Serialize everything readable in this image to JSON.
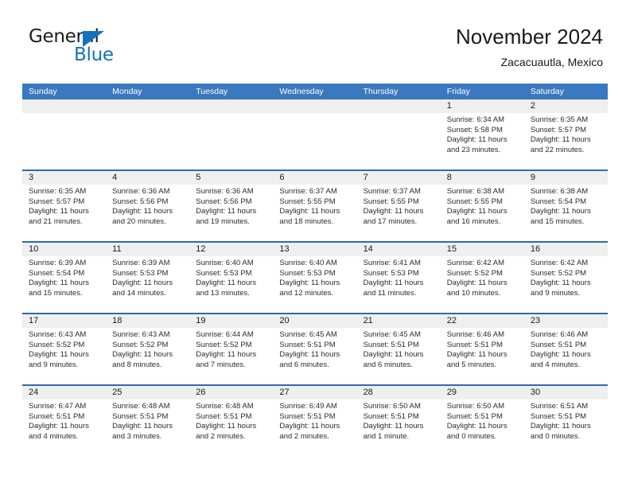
{
  "brand": {
    "name_part1": "General",
    "name_part2": "Blue",
    "accent_color": "#1272bd"
  },
  "header": {
    "title": "November 2024",
    "subtitle": "Zacacuautla, Mexico"
  },
  "colors": {
    "weekday_header_bg": "#3a79bf",
    "weekday_header_text": "#ffffff",
    "daynum_band_bg": "#efefef",
    "week_divider": "#2e6ca9"
  },
  "weekdays": [
    {
      "label": "Sunday"
    },
    {
      "label": "Monday"
    },
    {
      "label": "Tuesday"
    },
    {
      "label": "Wednesday"
    },
    {
      "label": "Thursday"
    },
    {
      "label": "Friday"
    },
    {
      "label": "Saturday"
    }
  ],
  "weeks": [
    {
      "days": [
        {
          "num": "",
          "lines": [
            "",
            "",
            "",
            ""
          ],
          "empty": true
        },
        {
          "num": "",
          "lines": [
            "",
            "",
            "",
            ""
          ],
          "empty": true
        },
        {
          "num": "",
          "lines": [
            "",
            "",
            "",
            ""
          ],
          "empty": true
        },
        {
          "num": "",
          "lines": [
            "",
            "",
            "",
            ""
          ],
          "empty": true
        },
        {
          "num": "",
          "lines": [
            "",
            "",
            "",
            ""
          ],
          "empty": true
        },
        {
          "num": "1",
          "lines": [
            "Sunrise: 6:34 AM",
            "Sunset: 5:58 PM",
            "Daylight: 11 hours",
            "and 23 minutes."
          ],
          "empty": false
        },
        {
          "num": "2",
          "lines": [
            "Sunrise: 6:35 AM",
            "Sunset: 5:57 PM",
            "Daylight: 11 hours",
            "and 22 minutes."
          ],
          "empty": false
        }
      ]
    },
    {
      "days": [
        {
          "num": "3",
          "lines": [
            "Sunrise: 6:35 AM",
            "Sunset: 5:57 PM",
            "Daylight: 11 hours",
            "and 21 minutes."
          ],
          "empty": false
        },
        {
          "num": "4",
          "lines": [
            "Sunrise: 6:36 AM",
            "Sunset: 5:56 PM",
            "Daylight: 11 hours",
            "and 20 minutes."
          ],
          "empty": false
        },
        {
          "num": "5",
          "lines": [
            "Sunrise: 6:36 AM",
            "Sunset: 5:56 PM",
            "Daylight: 11 hours",
            "and 19 minutes."
          ],
          "empty": false
        },
        {
          "num": "6",
          "lines": [
            "Sunrise: 6:37 AM",
            "Sunset: 5:55 PM",
            "Daylight: 11 hours",
            "and 18 minutes."
          ],
          "empty": false
        },
        {
          "num": "7",
          "lines": [
            "Sunrise: 6:37 AM",
            "Sunset: 5:55 PM",
            "Daylight: 11 hours",
            "and 17 minutes."
          ],
          "empty": false
        },
        {
          "num": "8",
          "lines": [
            "Sunrise: 6:38 AM",
            "Sunset: 5:55 PM",
            "Daylight: 11 hours",
            "and 16 minutes."
          ],
          "empty": false
        },
        {
          "num": "9",
          "lines": [
            "Sunrise: 6:38 AM",
            "Sunset: 5:54 PM",
            "Daylight: 11 hours",
            "and 15 minutes."
          ],
          "empty": false
        }
      ]
    },
    {
      "days": [
        {
          "num": "10",
          "lines": [
            "Sunrise: 6:39 AM",
            "Sunset: 5:54 PM",
            "Daylight: 11 hours",
            "and 15 minutes."
          ],
          "empty": false
        },
        {
          "num": "11",
          "lines": [
            "Sunrise: 6:39 AM",
            "Sunset: 5:53 PM",
            "Daylight: 11 hours",
            "and 14 minutes."
          ],
          "empty": false
        },
        {
          "num": "12",
          "lines": [
            "Sunrise: 6:40 AM",
            "Sunset: 5:53 PM",
            "Daylight: 11 hours",
            "and 13 minutes."
          ],
          "empty": false
        },
        {
          "num": "13",
          "lines": [
            "Sunrise: 6:40 AM",
            "Sunset: 5:53 PM",
            "Daylight: 11 hours",
            "and 12 minutes."
          ],
          "empty": false
        },
        {
          "num": "14",
          "lines": [
            "Sunrise: 6:41 AM",
            "Sunset: 5:53 PM",
            "Daylight: 11 hours",
            "and 11 minutes."
          ],
          "empty": false
        },
        {
          "num": "15",
          "lines": [
            "Sunrise: 6:42 AM",
            "Sunset: 5:52 PM",
            "Daylight: 11 hours",
            "and 10 minutes."
          ],
          "empty": false
        },
        {
          "num": "16",
          "lines": [
            "Sunrise: 6:42 AM",
            "Sunset: 5:52 PM",
            "Daylight: 11 hours",
            "and 9 minutes."
          ],
          "empty": false
        }
      ]
    },
    {
      "days": [
        {
          "num": "17",
          "lines": [
            "Sunrise: 6:43 AM",
            "Sunset: 5:52 PM",
            "Daylight: 11 hours",
            "and 9 minutes."
          ],
          "empty": false
        },
        {
          "num": "18",
          "lines": [
            "Sunrise: 6:43 AM",
            "Sunset: 5:52 PM",
            "Daylight: 11 hours",
            "and 8 minutes."
          ],
          "empty": false
        },
        {
          "num": "19",
          "lines": [
            "Sunrise: 6:44 AM",
            "Sunset: 5:52 PM",
            "Daylight: 11 hours",
            "and 7 minutes."
          ],
          "empty": false
        },
        {
          "num": "20",
          "lines": [
            "Sunrise: 6:45 AM",
            "Sunset: 5:51 PM",
            "Daylight: 11 hours",
            "and 6 minutes."
          ],
          "empty": false
        },
        {
          "num": "21",
          "lines": [
            "Sunrise: 6:45 AM",
            "Sunset: 5:51 PM",
            "Daylight: 11 hours",
            "and 6 minutes."
          ],
          "empty": false
        },
        {
          "num": "22",
          "lines": [
            "Sunrise: 6:46 AM",
            "Sunset: 5:51 PM",
            "Daylight: 11 hours",
            "and 5 minutes."
          ],
          "empty": false
        },
        {
          "num": "23",
          "lines": [
            "Sunrise: 6:46 AM",
            "Sunset: 5:51 PM",
            "Daylight: 11 hours",
            "and 4 minutes."
          ],
          "empty": false
        }
      ]
    },
    {
      "days": [
        {
          "num": "24",
          "lines": [
            "Sunrise: 6:47 AM",
            "Sunset: 5:51 PM",
            "Daylight: 11 hours",
            "and 4 minutes."
          ],
          "empty": false
        },
        {
          "num": "25",
          "lines": [
            "Sunrise: 6:48 AM",
            "Sunset: 5:51 PM",
            "Daylight: 11 hours",
            "and 3 minutes."
          ],
          "empty": false
        },
        {
          "num": "26",
          "lines": [
            "Sunrise: 6:48 AM",
            "Sunset: 5:51 PM",
            "Daylight: 11 hours",
            "and 2 minutes."
          ],
          "empty": false
        },
        {
          "num": "27",
          "lines": [
            "Sunrise: 6:49 AM",
            "Sunset: 5:51 PM",
            "Daylight: 11 hours",
            "and 2 minutes."
          ],
          "empty": false
        },
        {
          "num": "28",
          "lines": [
            "Sunrise: 6:50 AM",
            "Sunset: 5:51 PM",
            "Daylight: 11 hours",
            "and 1 minute."
          ],
          "empty": false
        },
        {
          "num": "29",
          "lines": [
            "Sunrise: 6:50 AM",
            "Sunset: 5:51 PM",
            "Daylight: 11 hours",
            "and 0 minutes."
          ],
          "empty": false
        },
        {
          "num": "30",
          "lines": [
            "Sunrise: 6:51 AM",
            "Sunset: 5:51 PM",
            "Daylight: 11 hours",
            "and 0 minutes."
          ],
          "empty": false
        }
      ]
    }
  ]
}
